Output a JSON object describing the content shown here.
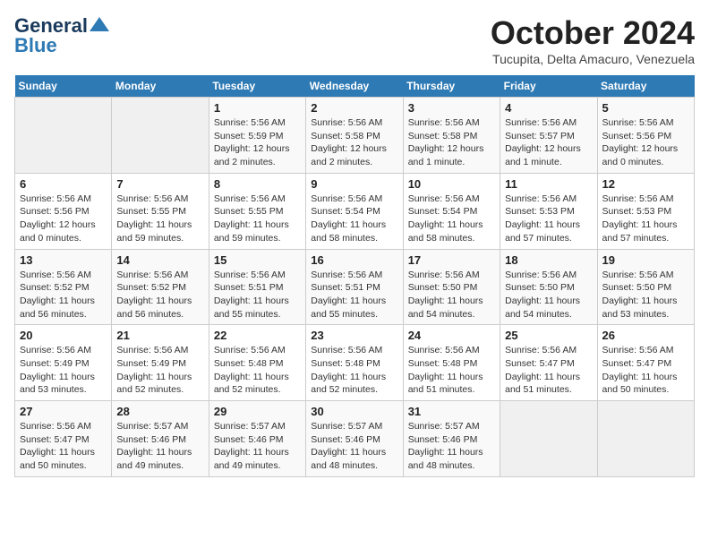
{
  "header": {
    "logo_line1": "General",
    "logo_line2": "Blue",
    "month_title": "October 2024",
    "location": "Tucupita, Delta Amacuro, Venezuela"
  },
  "weekdays": [
    "Sunday",
    "Monday",
    "Tuesday",
    "Wednesday",
    "Thursday",
    "Friday",
    "Saturday"
  ],
  "weeks": [
    [
      {
        "day": "",
        "detail": ""
      },
      {
        "day": "",
        "detail": ""
      },
      {
        "day": "1",
        "detail": "Sunrise: 5:56 AM\nSunset: 5:59 PM\nDaylight: 12 hours\nand 2 minutes."
      },
      {
        "day": "2",
        "detail": "Sunrise: 5:56 AM\nSunset: 5:58 PM\nDaylight: 12 hours\nand 2 minutes."
      },
      {
        "day": "3",
        "detail": "Sunrise: 5:56 AM\nSunset: 5:58 PM\nDaylight: 12 hours\nand 1 minute."
      },
      {
        "day": "4",
        "detail": "Sunrise: 5:56 AM\nSunset: 5:57 PM\nDaylight: 12 hours\nand 1 minute."
      },
      {
        "day": "5",
        "detail": "Sunrise: 5:56 AM\nSunset: 5:56 PM\nDaylight: 12 hours\nand 0 minutes."
      }
    ],
    [
      {
        "day": "6",
        "detail": "Sunrise: 5:56 AM\nSunset: 5:56 PM\nDaylight: 12 hours\nand 0 minutes."
      },
      {
        "day": "7",
        "detail": "Sunrise: 5:56 AM\nSunset: 5:55 PM\nDaylight: 11 hours\nand 59 minutes."
      },
      {
        "day": "8",
        "detail": "Sunrise: 5:56 AM\nSunset: 5:55 PM\nDaylight: 11 hours\nand 59 minutes."
      },
      {
        "day": "9",
        "detail": "Sunrise: 5:56 AM\nSunset: 5:54 PM\nDaylight: 11 hours\nand 58 minutes."
      },
      {
        "day": "10",
        "detail": "Sunrise: 5:56 AM\nSunset: 5:54 PM\nDaylight: 11 hours\nand 58 minutes."
      },
      {
        "day": "11",
        "detail": "Sunrise: 5:56 AM\nSunset: 5:53 PM\nDaylight: 11 hours\nand 57 minutes."
      },
      {
        "day": "12",
        "detail": "Sunrise: 5:56 AM\nSunset: 5:53 PM\nDaylight: 11 hours\nand 57 minutes."
      }
    ],
    [
      {
        "day": "13",
        "detail": "Sunrise: 5:56 AM\nSunset: 5:52 PM\nDaylight: 11 hours\nand 56 minutes."
      },
      {
        "day": "14",
        "detail": "Sunrise: 5:56 AM\nSunset: 5:52 PM\nDaylight: 11 hours\nand 56 minutes."
      },
      {
        "day": "15",
        "detail": "Sunrise: 5:56 AM\nSunset: 5:51 PM\nDaylight: 11 hours\nand 55 minutes."
      },
      {
        "day": "16",
        "detail": "Sunrise: 5:56 AM\nSunset: 5:51 PM\nDaylight: 11 hours\nand 55 minutes."
      },
      {
        "day": "17",
        "detail": "Sunrise: 5:56 AM\nSunset: 5:50 PM\nDaylight: 11 hours\nand 54 minutes."
      },
      {
        "day": "18",
        "detail": "Sunrise: 5:56 AM\nSunset: 5:50 PM\nDaylight: 11 hours\nand 54 minutes."
      },
      {
        "day": "19",
        "detail": "Sunrise: 5:56 AM\nSunset: 5:50 PM\nDaylight: 11 hours\nand 53 minutes."
      }
    ],
    [
      {
        "day": "20",
        "detail": "Sunrise: 5:56 AM\nSunset: 5:49 PM\nDaylight: 11 hours\nand 53 minutes."
      },
      {
        "day": "21",
        "detail": "Sunrise: 5:56 AM\nSunset: 5:49 PM\nDaylight: 11 hours\nand 52 minutes."
      },
      {
        "day": "22",
        "detail": "Sunrise: 5:56 AM\nSunset: 5:48 PM\nDaylight: 11 hours\nand 52 minutes."
      },
      {
        "day": "23",
        "detail": "Sunrise: 5:56 AM\nSunset: 5:48 PM\nDaylight: 11 hours\nand 52 minutes."
      },
      {
        "day": "24",
        "detail": "Sunrise: 5:56 AM\nSunset: 5:48 PM\nDaylight: 11 hours\nand 51 minutes."
      },
      {
        "day": "25",
        "detail": "Sunrise: 5:56 AM\nSunset: 5:47 PM\nDaylight: 11 hours\nand 51 minutes."
      },
      {
        "day": "26",
        "detail": "Sunrise: 5:56 AM\nSunset: 5:47 PM\nDaylight: 11 hours\nand 50 minutes."
      }
    ],
    [
      {
        "day": "27",
        "detail": "Sunrise: 5:56 AM\nSunset: 5:47 PM\nDaylight: 11 hours\nand 50 minutes."
      },
      {
        "day": "28",
        "detail": "Sunrise: 5:57 AM\nSunset: 5:46 PM\nDaylight: 11 hours\nand 49 minutes."
      },
      {
        "day": "29",
        "detail": "Sunrise: 5:57 AM\nSunset: 5:46 PM\nDaylight: 11 hours\nand 49 minutes."
      },
      {
        "day": "30",
        "detail": "Sunrise: 5:57 AM\nSunset: 5:46 PM\nDaylight: 11 hours\nand 48 minutes."
      },
      {
        "day": "31",
        "detail": "Sunrise: 5:57 AM\nSunset: 5:46 PM\nDaylight: 11 hours\nand 48 minutes."
      },
      {
        "day": "",
        "detail": ""
      },
      {
        "day": "",
        "detail": ""
      }
    ]
  ]
}
